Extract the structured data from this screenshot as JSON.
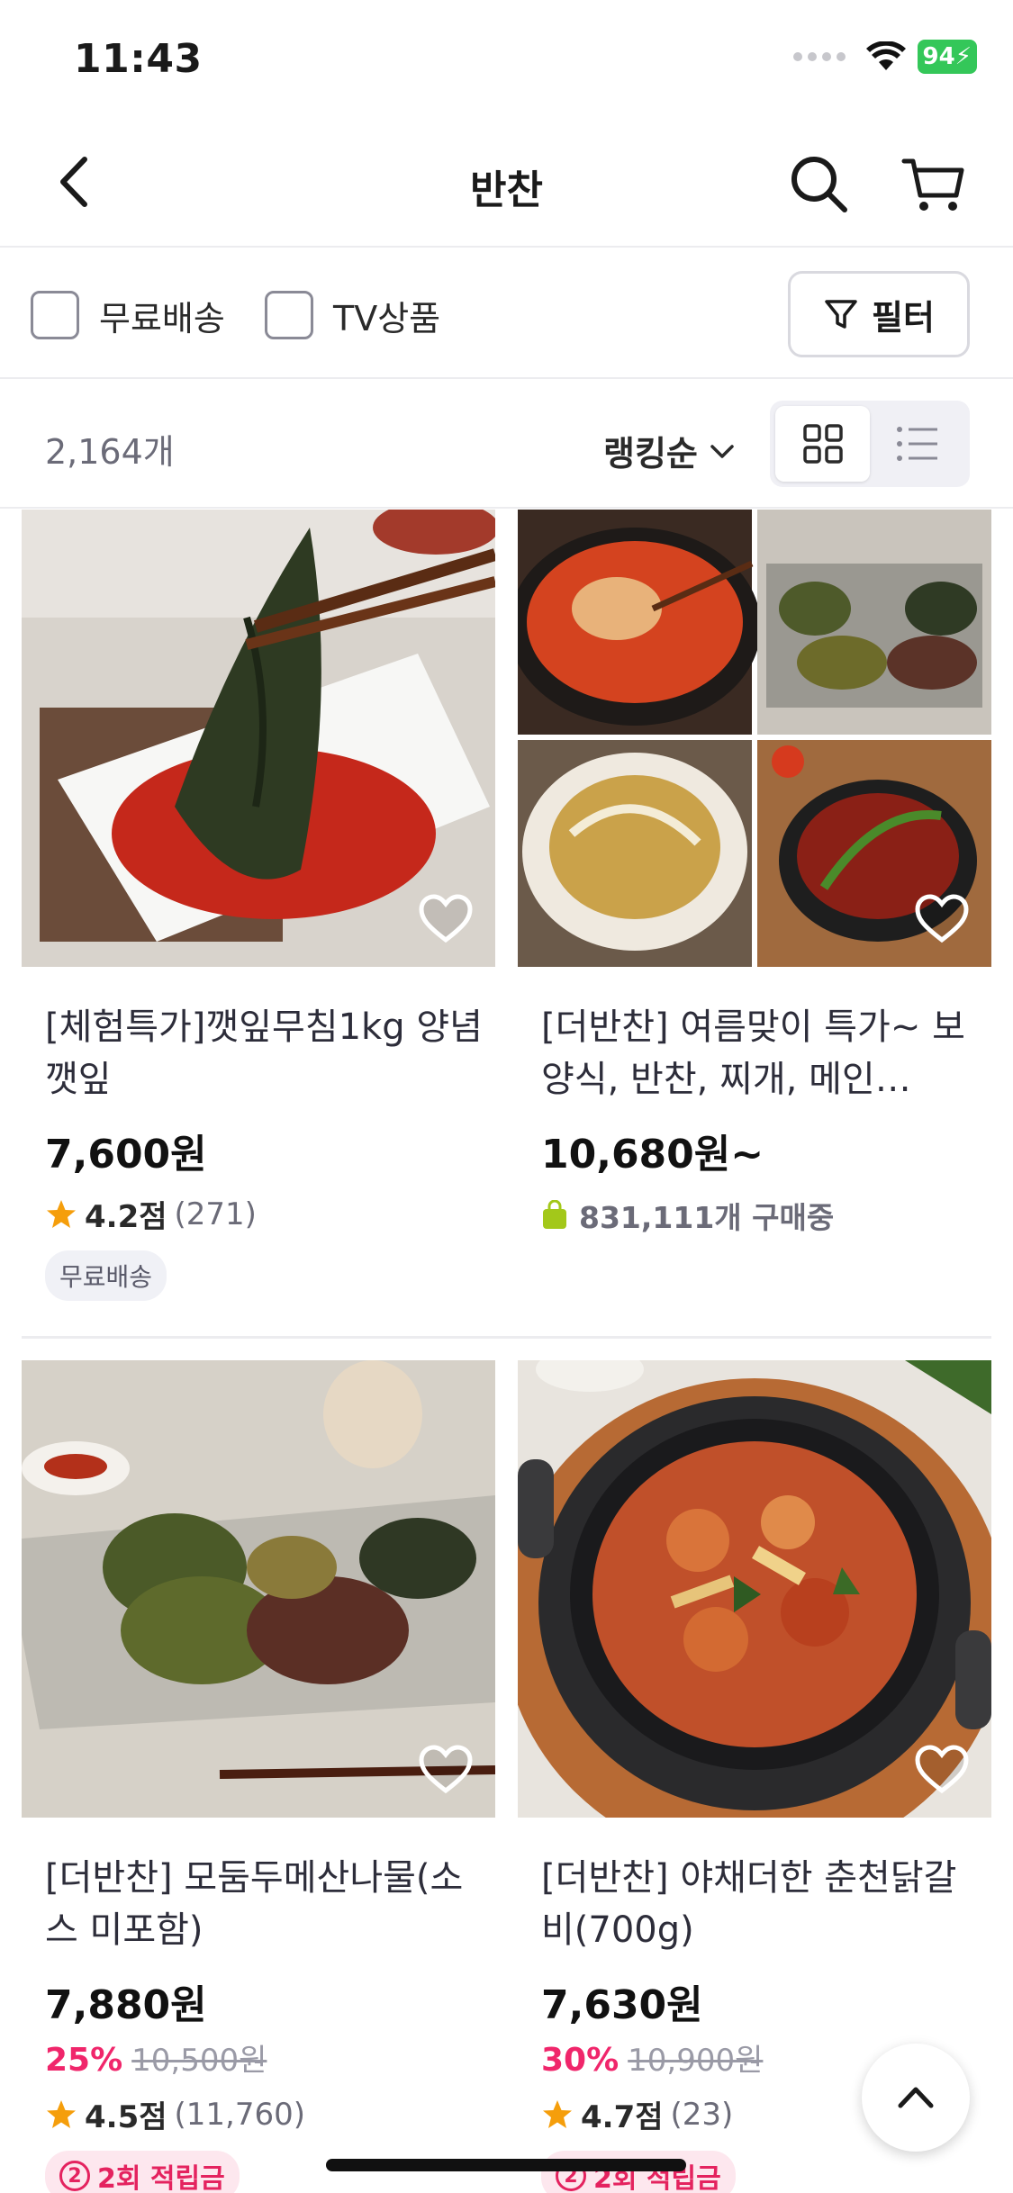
{
  "status_bar": {
    "time": "11:43",
    "battery": "94"
  },
  "header": {
    "title": "반찬"
  },
  "filters": {
    "free_shipping": "무료배송",
    "tv_product": "TV상품",
    "filter_button": "필터"
  },
  "list": {
    "count": "2,164개",
    "sort": "랭킹순"
  },
  "products": [
    {
      "title": "[체험특가]깻잎무침1kg 양념깻잎",
      "price": "7,600원",
      "rating": "4.2점",
      "rating_count": "(271)",
      "tag": "무료배송"
    },
    {
      "title": "[더반찬] 여름맞이 특가~ 보양식, 반찬, 찌개, 메인…",
      "price": "10,680원~",
      "buying": "831,111개 구매중"
    },
    {
      "title": "[더반찬] 모둠두메산나물(소스 미포함)",
      "price": "7,880원",
      "discount_rate": "25%",
      "original_price": "10,500원",
      "rating": "4.5점",
      "rating_count": "(11,760)",
      "point_num": "2",
      "point_label": "2회 적립금"
    },
    {
      "title": "[더반찬] 야채더한 춘천닭갈비(700g)",
      "price": "7,630원",
      "discount_rate": "30%",
      "original_price": "10,900원",
      "rating": "4.7점",
      "rating_count": "(23)",
      "point_num": "2",
      "point_label": "2회 적립금"
    }
  ],
  "colors": {
    "accent_pink": "#f0266b",
    "star": "#f59e0b",
    "battery": "#34c759",
    "buying_bag": "#a3c81a"
  }
}
